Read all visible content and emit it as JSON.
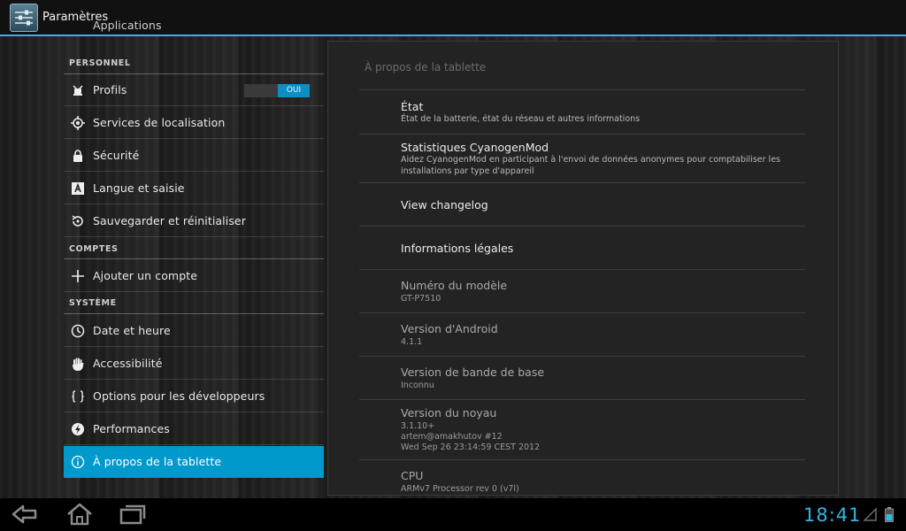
{
  "actionbar": {
    "title": "Paramètres",
    "icon": "settings-icon"
  },
  "left": {
    "cut_item": "Applications",
    "sections": {
      "personal": "PERSONNEL",
      "accounts": "COMPTES",
      "system": "SYSTÈME"
    },
    "items": {
      "profiles": "Profils",
      "location": "Services de localisation",
      "security": "Sécurité",
      "language": "Langue et saisie",
      "backup": "Sauvegarder et réinitialiser",
      "add_account": "Ajouter un compte",
      "date": "Date et heure",
      "accessibility": "Accessibilité",
      "developer": "Options pour les développeurs",
      "performance": "Performances",
      "about": "À propos de la tablette"
    },
    "profiles_toggle": "OUI"
  },
  "right": {
    "title": "À propos de la tablette",
    "items": [
      {
        "title": "État",
        "summary": "État de la batterie, état du réseau et autres informations"
      },
      {
        "title": "Statistiques CyanogenMod",
        "summary": "Aidez CyanogenMod en participant à l'envoi de données anonymes pour comptabiliser les",
        "summary2": "installations par type d'appareil"
      },
      {
        "title": "View changelog"
      },
      {
        "title": "Informations légales"
      },
      {
        "title": "Numéro du modèle",
        "summary": "GT-P7510"
      },
      {
        "title": "Version d'Android",
        "summary": "4.1.1"
      },
      {
        "title": "Version de bande de base",
        "summary": "Inconnu"
      },
      {
        "title": "Version du noyau",
        "summary": "3.1.10+",
        "summary2": "artem@amakhutov #12",
        "summary3": "Wed Sep 26 23:14:59 CEST 2012"
      },
      {
        "title": "CPU",
        "summary": "ARMv7 Processor rev 0 (v7l)"
      }
    ]
  },
  "navbar": {
    "clock": "18:41"
  },
  "colors": {
    "accent": "#33b5e5",
    "selected": "#0099cc"
  }
}
